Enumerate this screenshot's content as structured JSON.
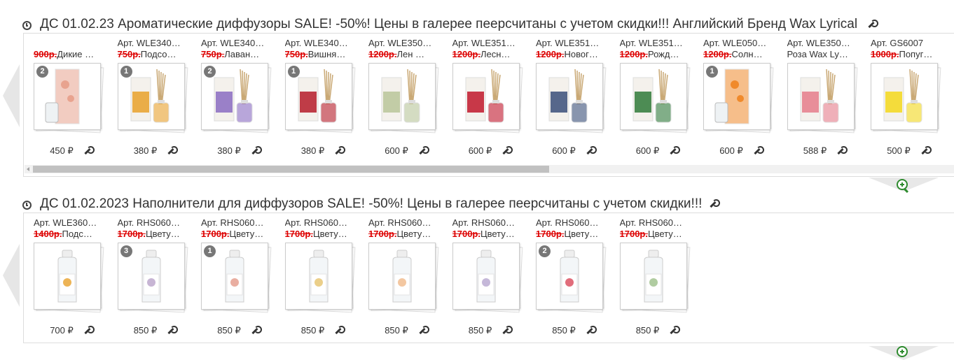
{
  "gallery1": {
    "title": "ДС 01.02.23  Ароматические диффузоры SALE! -50%! Цены в галерее пеерсчитаны с учетом скидки!!! Английский Бренд Wax Lyrical",
    "items": [
      {
        "art": "",
        "old": "900р.",
        "name": "Дикие …",
        "badge": "2",
        "price": "450 ₽",
        "color": "#e8a38f",
        "type": "box"
      },
      {
        "art": "Арт. WLE340…",
        "old": "750р.",
        "name": "Подсо…",
        "badge": "1",
        "price": "380 ₽",
        "color": "#e8a12c",
        "type": "diffuser"
      },
      {
        "art": "Арт. WLE340…",
        "old": "750р.",
        "name": "Лаван…",
        "badge": "2",
        "price": "380 ₽",
        "color": "#8a6cc2",
        "type": "diffuser"
      },
      {
        "art": "Арт. WLE340…",
        "old": "750р.",
        "name": "Вишня…",
        "badge": "1",
        "price": "380 ₽",
        "color": "#b51c2a",
        "type": "diffuser"
      },
      {
        "art": "Арт. WLE350…",
        "old": "1200р.",
        "name": "Лен …",
        "badge": "",
        "price": "600 ₽",
        "color": "#b8c59a",
        "type": "diffuser"
      },
      {
        "art": "Арт. WLE351…",
        "old": "1200р.",
        "name": "Лесн…",
        "badge": "",
        "price": "600 ₽",
        "color": "#c0172c",
        "type": "diffuser"
      },
      {
        "art": "Арт. WLE351…",
        "old": "1200р.",
        "name": "Новог…",
        "badge": "",
        "price": "600 ₽",
        "color": "#3a4f7a",
        "type": "diffuser"
      },
      {
        "art": "Арт. WLE351…",
        "old": "1200р.",
        "name": "Рожд…",
        "badge": "",
        "price": "600 ₽",
        "color": "#2f7a3a",
        "type": "diffuser"
      },
      {
        "art": "Арт. WLE050…",
        "old": "1200р.",
        "name": "Солн…",
        "badge": "1",
        "price": "600 ₽",
        "color": "#f08a2b",
        "type": "box"
      },
      {
        "art": "Арт. WLE350…",
        "old": "",
        "name": "Роза Wax Ly…",
        "badge": "",
        "price": "588 ₽",
        "color": "#e57d8b",
        "type": "diffuser"
      },
      {
        "art": "Арт. GS6007",
        "old": "1000р.",
        "name": "Попуг…",
        "badge": "",
        "price": "500 ₽",
        "color": "#f3d81c",
        "type": "diffuser"
      }
    ]
  },
  "gallery2": {
    "title": "ДС 01.02.2023 Наполнители для диффузоров SALE! -50%! Цены в галерее пеерсчитаны с учетом скидки!!!",
    "items": [
      {
        "art": "Арт. WLE360…",
        "old": "1400р.",
        "name": "Подс…",
        "badge": "",
        "price": "700 ₽",
        "color": "#e8a12c",
        "type": "bottle"
      },
      {
        "art": "Арт. RHS060…",
        "old": "1700р.",
        "name": "Цвету…",
        "badge": "3",
        "price": "850 ₽",
        "color": "#b9a3c9",
        "type": "bottle"
      },
      {
        "art": "Арт. RHS060…",
        "old": "1700р.",
        "name": "Цвету…",
        "badge": "1",
        "price": "850 ₽",
        "color": "#e49a8a",
        "type": "bottle"
      },
      {
        "art": "Арт. RHS060…",
        "old": "1700р.",
        "name": "Цвету…",
        "badge": "",
        "price": "850 ₽",
        "color": "#e6c36d",
        "type": "bottle"
      },
      {
        "art": "Арт. RHS060…",
        "old": "1700р.",
        "name": "Цвету…",
        "badge": "",
        "price": "850 ₽",
        "color": "#f0b98a",
        "type": "bottle"
      },
      {
        "art": "Арт. RHS060…",
        "old": "1700р.",
        "name": "Цвету…",
        "badge": "",
        "price": "850 ₽",
        "color": "#b7a6cf",
        "type": "bottle"
      },
      {
        "art": "Арт. RHS060…",
        "old": "1700р.",
        "name": "Цвету…",
        "badge": "2",
        "price": "850 ₽",
        "color": "#d9485a",
        "type": "bottle"
      },
      {
        "art": "Арт. RHS060…",
        "old": "1700р.",
        "name": "Цвету…",
        "badge": "",
        "price": "850 ₽",
        "color": "#9cbf8a",
        "type": "bottle"
      }
    ]
  }
}
